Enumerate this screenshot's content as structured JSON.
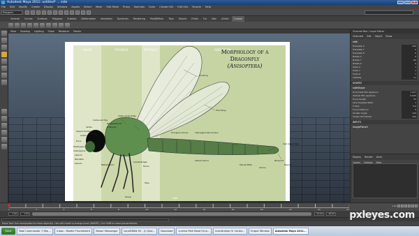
{
  "window": {
    "title": "Autodesk Maya 2011: untitled*   ...   side",
    "buttons": [
      "_",
      "□",
      "×"
    ]
  },
  "menus": [
    "File",
    "Edit",
    "Modify",
    "Create",
    "Display",
    "Window",
    "Assets",
    "Select",
    "Mesh",
    "Edit Mesh",
    "Proxy",
    "Normals",
    "Color",
    "Create UVs",
    "Edit UVs",
    "Muscle",
    "Help"
  ],
  "status": {
    "mode": "Polygons"
  },
  "shelf_tabs": [
    "General",
    "Curves",
    "Surfaces",
    "Polygons",
    "Subdivs",
    "Deformation",
    "Animation",
    "Dynamics",
    "Rendering",
    "PaintEffects",
    "Toon",
    "Muscle",
    "Fluids",
    "Fur",
    "Hair",
    "nCloth",
    "Custom"
  ],
  "shelf_active": "Custom",
  "panel_menu": [
    "View",
    "Shading",
    "Lighting",
    "Show",
    "Renderer",
    "Panels"
  ],
  "viewport": {
    "label": "side"
  },
  "image_plane": {
    "bands": {
      "head": "HEAD",
      "thorax": "THORAX",
      "petiole": "PETIOLE",
      "abdomen": "ABDOMEN"
    },
    "title_line1": "Morphology of a",
    "title_line2": "Dragonfly",
    "title_line3": "(Anisoptera)",
    "annotations": {
      "forewing": "Forewing",
      "hindwing": "Hind Wing",
      "ant_ridge": "Antero-Axial Ridge",
      "comp_eye": "Compound Eye",
      "mesepisternum": "Mesepisternum",
      "prothorax": "Prothorax",
      "lateral_ocellus": "Lateral Ocellus",
      "vertex": "Vertex",
      "antenna": "Antenna",
      "frons": "Frons",
      "postclypeus": "Postclypeus",
      "anteclypeus": "Anteclypeus",
      "labrum": "Labrum",
      "mandible": "Mandible",
      "labium": "Labium",
      "metepimeron": "Metepimeron",
      "lobate_ridges": "Lobate Ridges",
      "femur": "Femur",
      "tibia": "Tibia",
      "tarsus": "Tarsus",
      "triangle": "Triangular Oculus",
      "intersegmental": "Intersegmental Annulus",
      "lateral_carina": "Lateral Carina",
      "sternal_plate": "Sternal Plate",
      "caudal_appendage": "Anal Appendage",
      "cercus": "Cercus",
      "paraproct": "Paraproct",
      "epiproct": "Epiproct"
    }
  },
  "sidepanel": {
    "header": "Channel Box / Layer Editor",
    "tabs": [
      "Channels",
      "Edit",
      "Object",
      "Show"
    ],
    "object": "side",
    "attrs": [
      {
        "name": "Translate X",
        "value": "-100"
      },
      {
        "name": "Translate Y",
        "value": "0"
      },
      {
        "name": "Translate Z",
        "value": "0"
      },
      {
        "name": "Rotate X",
        "value": "0"
      },
      {
        "name": "Rotate Y",
        "value": "-90"
      },
      {
        "name": "Rotate Z",
        "value": "0"
      },
      {
        "name": "Scale X",
        "value": "1"
      },
      {
        "name": "Scale Y",
        "value": "1"
      },
      {
        "name": "Scale Z",
        "value": "1"
      },
      {
        "name": "Visibility",
        "value": "on"
      }
    ],
    "shapes_label": "SHAPES",
    "shape_name": "sideShape",
    "shape_attrs": [
      {
        "name": "Horizontal Film Aperture",
        "value": "1.417"
      },
      {
        "name": "Vertical Film Aperture",
        "value": "0.945"
      },
      {
        "name": "Focal Length",
        "value": "35"
      },
      {
        "name": "Lens Squeeze Ratio",
        "value": "1"
      },
      {
        "name": "F Stop",
        "value": "5.6"
      },
      {
        "name": "Focus Distance",
        "value": "5"
      },
      {
        "name": "Shutter Angle",
        "value": "144"
      },
      {
        "name": "Center Of Interest",
        "value": "100"
      }
    ],
    "inputs_label": "INPUTS",
    "input_name": "imagePlane1",
    "layers_tabs": [
      "Display",
      "Render",
      "Anim"
    ],
    "layers_menu": [
      "Layers",
      "Options",
      "Help"
    ]
  },
  "timeline": {
    "ticks": [
      "1",
      "2",
      "4",
      "6",
      "8",
      "10",
      "12",
      "14",
      "16",
      "18",
      "20",
      "22",
      "24"
    ],
    "current": "1.00"
  },
  "range": {
    "start": "1.00",
    "inner_start": "1.00",
    "end": "24.00",
    "outer_end": "48.00",
    "anim_layer": "No Anim Layer",
    "char_set": "No Character Set"
  },
  "help_line": "Move Tool: Use manipulator to move object(s). Use edit mode to change pivot (INSERT). Ctrl+LMB to move perpendicular.",
  "taskbar": {
    "start": "Start",
    "tasks": [
      "Total Commander 7.56a ...",
      "Inbox - Mozilla Thunderbird",
      "Yahoo! Messenger",
      "CorelDRAW X5 - [C:\\Doc...",
      "Download",
      "Lumina Path Bead Orna...",
      "Inverdraheo Or Cortex...",
      "Output Window",
      "Autodesk Maya 2011..."
    ]
  },
  "watermark": "pxleyes.com"
}
